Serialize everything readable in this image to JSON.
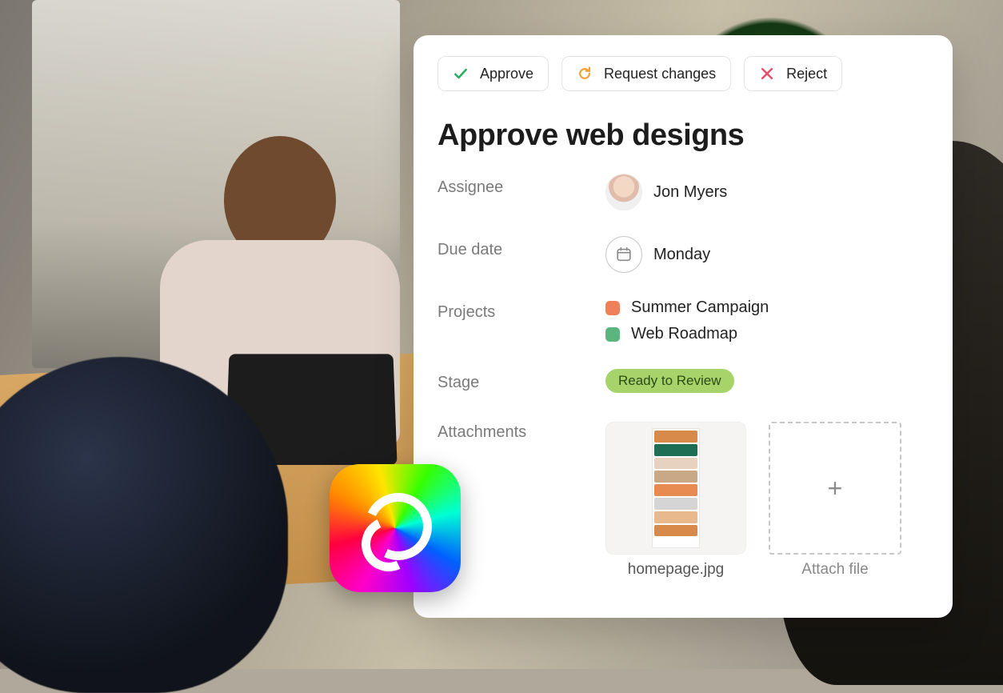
{
  "actions": {
    "approve": "Approve",
    "request_changes": "Request changes",
    "reject": "Reject"
  },
  "task": {
    "title": "Approve web designs"
  },
  "labels": {
    "assignee": "Assignee",
    "due_date": "Due date",
    "projects": "Projects",
    "stage": "Stage",
    "attachments": "Attachments"
  },
  "assignee": {
    "name": "Jon Myers"
  },
  "due_date": {
    "value": "Monday"
  },
  "projects": [
    {
      "name": "Summer Campaign",
      "color": "#f0805a"
    },
    {
      "name": "Web Roadmap",
      "color": "#5cb57f"
    }
  ],
  "stage": {
    "label": "Ready to Review",
    "bg": "#a6d46a",
    "fg": "#2e4a14"
  },
  "attachments": {
    "items": [
      {
        "name": "homepage.jpg"
      }
    ],
    "add_label": "Attach file"
  },
  "integration_icon": "adobe-creative-cloud-icon"
}
